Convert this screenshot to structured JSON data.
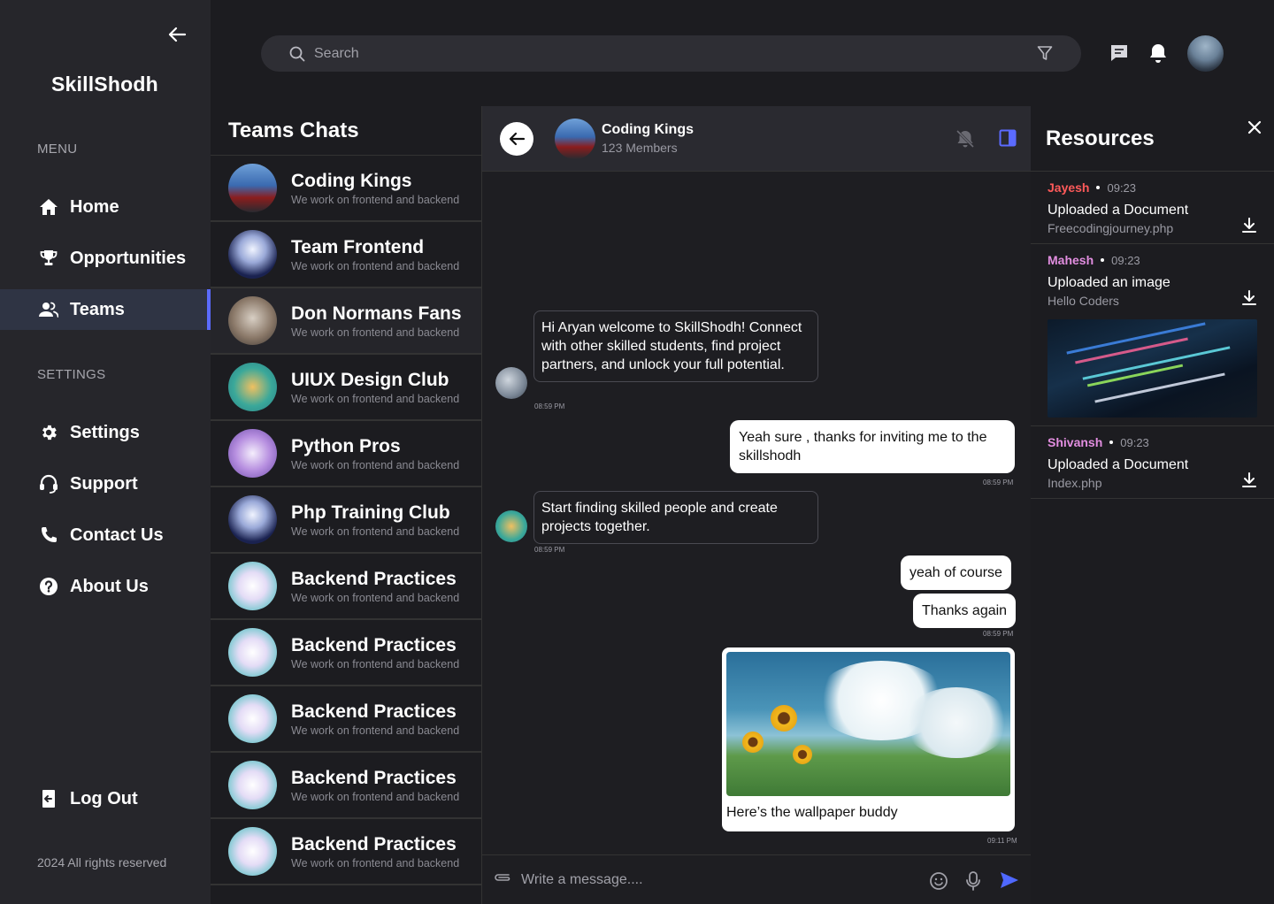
{
  "sidebar": {
    "brand": "SkillShodh",
    "menu_label": "MENU",
    "settings_label": "SETTINGS",
    "menu_items": [
      {
        "label": "Home",
        "icon": "home-icon"
      },
      {
        "label": "Opportunities",
        "icon": "trophy-icon"
      },
      {
        "label": "Teams",
        "icon": "users-icon",
        "active": true
      }
    ],
    "settings_items": [
      {
        "label": "Settings",
        "icon": "gear-icon"
      },
      {
        "label": "Support",
        "icon": "headset-icon"
      },
      {
        "label": "Contact Us",
        "icon": "phone-icon"
      },
      {
        "label": "About Us",
        "icon": "help-icon"
      }
    ],
    "logout": "Log Out",
    "footer": "2024 All rights reserved"
  },
  "topbar": {
    "search_placeholder": "Search"
  },
  "teams": {
    "title": "Teams Chats",
    "items": [
      {
        "name": "Coding Kings",
        "desc": "We work on frontend and backend"
      },
      {
        "name": "Team Frontend",
        "desc": "We work on frontend and backend"
      },
      {
        "name": "Don Normans Fans",
        "desc": "We work on frontend and backend"
      },
      {
        "name": "UIUX Design Club",
        "desc": "We work on frontend and backend"
      },
      {
        "name": "Python Pros",
        "desc": "We work on frontend and backend"
      },
      {
        "name": "Php Training Club",
        "desc": "We work on frontend and backend"
      },
      {
        "name": "Backend Practices",
        "desc": "We work on frontend and backend"
      },
      {
        "name": "Backend Practices",
        "desc": "We work on frontend and backend"
      },
      {
        "name": "Backend Practices",
        "desc": "We work on frontend and backend"
      },
      {
        "name": "Backend Practices",
        "desc": "We work on frontend and backend"
      },
      {
        "name": "Backend Practices",
        "desc": "We work on frontend and backend"
      }
    ]
  },
  "chat": {
    "title": "Coding Kings",
    "subtitle": "123 Members",
    "messages": [
      {
        "dir": "in",
        "text": "Hi Aryan welcome to SkillShodh! Connect with other skilled students, find project partners, and unlock your full potential.",
        "time": "08:59 PM"
      },
      {
        "dir": "out",
        "text": "Yeah sure , thanks for inviting me to the skillshodh",
        "time": "08:59 PM"
      },
      {
        "dir": "in",
        "text": "Start finding skilled people and create projects together.",
        "time": "08:59 PM"
      },
      {
        "dir": "out",
        "text": "yeah of course",
        "time": ""
      },
      {
        "dir": "out",
        "text": "Thanks again",
        "time": "08:59 PM"
      },
      {
        "dir": "out",
        "text": "Here’s the wallpaper buddy",
        "time": "09:11 PM"
      }
    ],
    "composer_placeholder": "Write a message...."
  },
  "resources": {
    "title": "Resources",
    "items": [
      {
        "user": "Jayesh",
        "user_color": "#ff5a5a",
        "time": "09:23",
        "action": "Uploaded a Document",
        "file": "Freecodingjourney.php"
      },
      {
        "user": "Mahesh",
        "user_color": "#e28ee0",
        "time": "09:23",
        "action": "Uploaded an image",
        "file": "Hello Coders"
      },
      {
        "user": "Shivansh",
        "user_color": "#e28ee0",
        "time": "09:23",
        "action": "Uploaded a Document",
        "file": "Index.php"
      }
    ]
  },
  "colors": {
    "accent": "#5b6bff",
    "sidebar_bg": "#26262b",
    "active_bg": "#2f3444"
  }
}
